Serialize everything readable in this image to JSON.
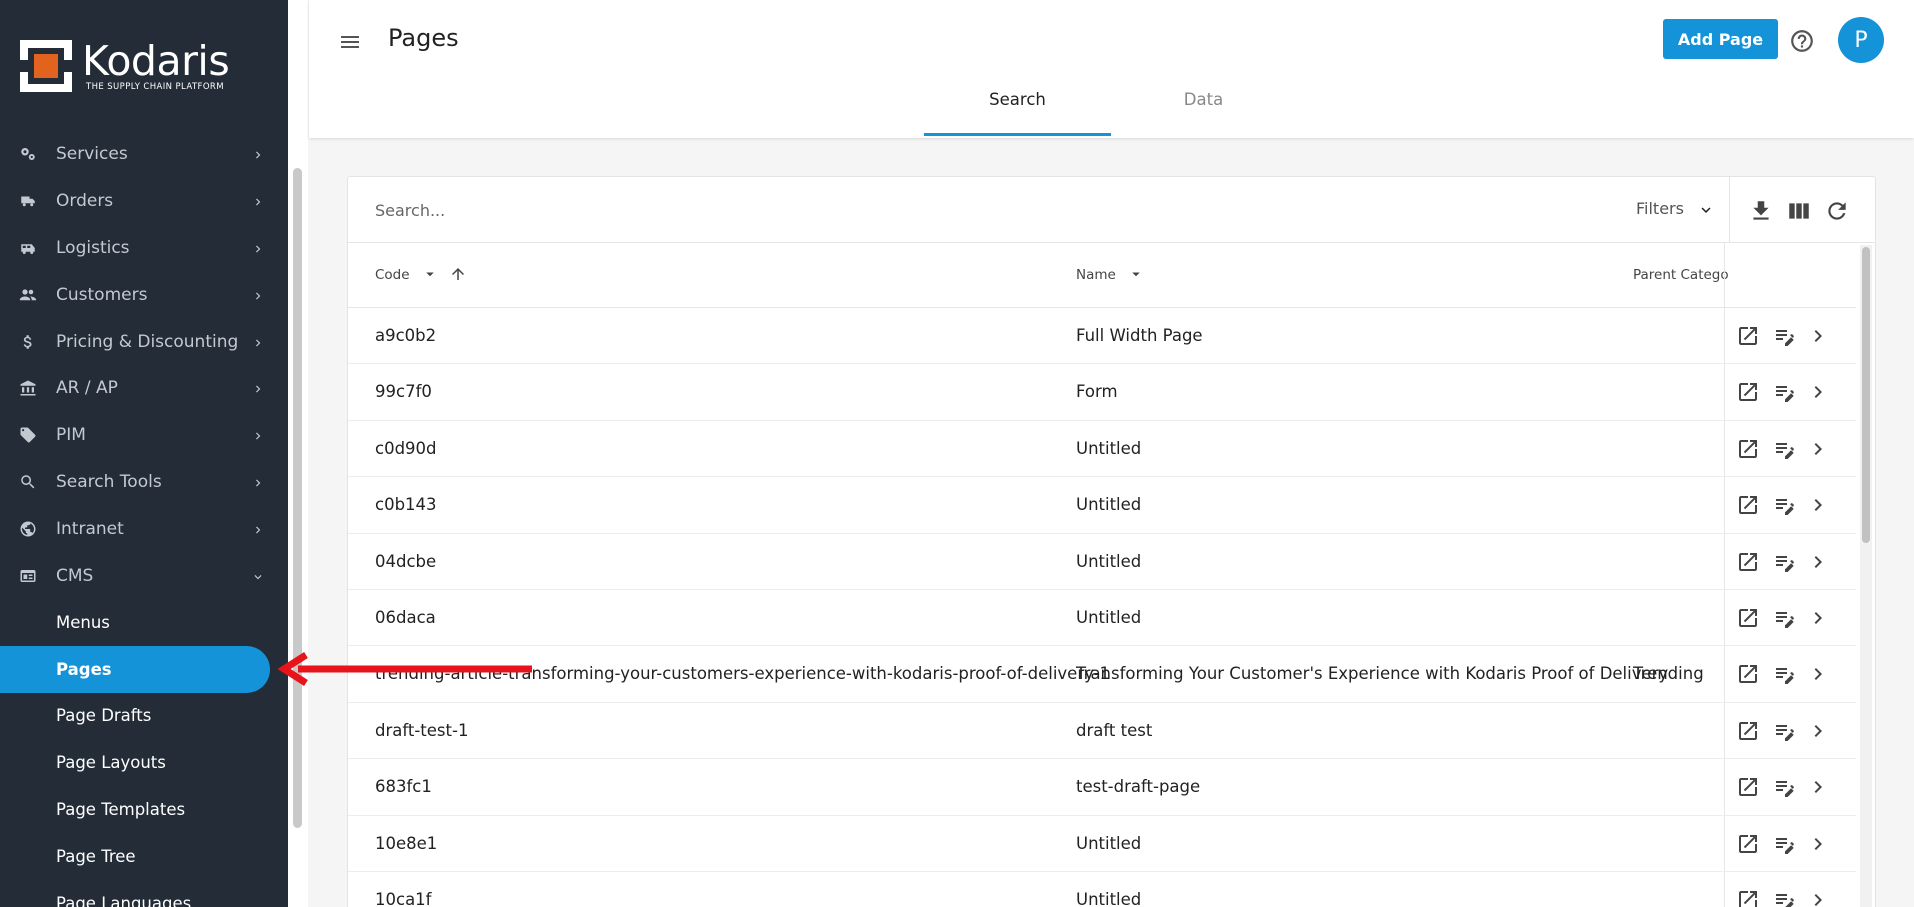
{
  "brand": {
    "name": "Kodaris",
    "tagline": "THE SUPPLY CHAIN PLATFORM",
    "accent": "#1493d9",
    "sidebar_bg": "#232c37"
  },
  "sidebar": {
    "items": [
      {
        "label": "Services",
        "icon": "gears-icon"
      },
      {
        "label": "Orders",
        "icon": "truck-icon"
      },
      {
        "label": "Logistics",
        "icon": "shuttle-icon"
      },
      {
        "label": "Customers",
        "icon": "people-icon"
      },
      {
        "label": "Pricing & Discounting",
        "icon": "dollar-icon"
      },
      {
        "label": "AR / AP",
        "icon": "bank-icon"
      },
      {
        "label": "PIM",
        "icon": "tag-icon"
      },
      {
        "label": "Search Tools",
        "icon": "search-icon"
      },
      {
        "label": "Intranet",
        "icon": "globe-icon"
      },
      {
        "label": "CMS",
        "icon": "cms-icon"
      }
    ],
    "cms_sub": [
      "Menus",
      "Pages",
      "Page Drafts",
      "Page Layouts",
      "Page Templates",
      "Page Tree",
      "Page Languages"
    ],
    "active_sub": "Pages"
  },
  "header": {
    "title": "Pages",
    "add_label": "Add Page",
    "avatar_initial": "P"
  },
  "tabs": {
    "search": "Search",
    "data": "Data",
    "active": "Search"
  },
  "search": {
    "placeholder": "Search...",
    "filters_label": "Filters"
  },
  "table": {
    "columns": {
      "code": "Code",
      "name": "Name",
      "parent": "Parent Catego"
    },
    "rows": [
      {
        "code": "a9c0b2",
        "name": "Full Width Page",
        "parent": ""
      },
      {
        "code": "99c7f0",
        "name": "Form",
        "parent": ""
      },
      {
        "code": "c0d90d",
        "name": "Untitled",
        "parent": ""
      },
      {
        "code": "c0b143",
        "name": "Untitled",
        "parent": ""
      },
      {
        "code": "04dcbe",
        "name": "Untitled",
        "parent": ""
      },
      {
        "code": "06daca",
        "name": "Untitled",
        "parent": ""
      },
      {
        "code": "trending-article-transforming-your-customers-experience-with-kodaris-proof-of-delivery-1",
        "name": "Transforming Your Customer's Experience with Kodaris Proof of Delivery",
        "parent": "Trending"
      },
      {
        "code": "draft-test-1",
        "name": "draft test",
        "parent": ""
      },
      {
        "code": "683fc1",
        "name": "test-draft-page",
        "parent": ""
      },
      {
        "code": "10e8e1",
        "name": "Untitled",
        "parent": ""
      },
      {
        "code": "10ca1f",
        "name": "Untitled",
        "parent": ""
      }
    ]
  },
  "annotation": {
    "arrow_color": "#e8141b"
  }
}
